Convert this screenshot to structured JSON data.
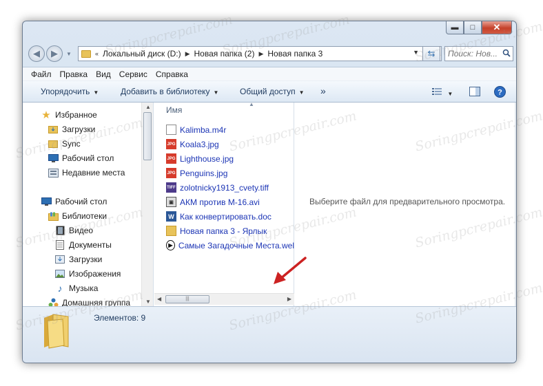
{
  "window": {
    "caption_buttons": {
      "minimize": "▬",
      "maximize": "□",
      "close": "✕"
    }
  },
  "address_bar": {
    "overflow": "«",
    "breadcrumbs": [
      "Локальный диск (D:)",
      "Новая папка (2)",
      "Новая папка 3"
    ],
    "search_placeholder": "Поиск: Нов..."
  },
  "menu": [
    "Файл",
    "Правка",
    "Вид",
    "Сервис",
    "Справка"
  ],
  "toolbar": {
    "organize": "Упорядочить",
    "add_to_library": "Добавить в библиотеку",
    "share": "Общий доступ",
    "more": "»"
  },
  "nav_pane": {
    "favorites": "Избранное",
    "favorites_items": [
      "Загрузки",
      "Sync",
      "Рабочий стол",
      "Недавние места"
    ],
    "desktop": "Рабочий стол",
    "libraries": "Библиотеки",
    "library_items": [
      "Видео",
      "Документы",
      "Загрузки",
      "Изображения",
      "Музыка"
    ],
    "homegroup": "Домашняя группа"
  },
  "file_list": {
    "column_name": "Имя",
    "files": [
      {
        "name": "Kalimba.m4r",
        "icon": "doc-icon"
      },
      {
        "name": "Koala3.jpg",
        "icon": "jpg-icon"
      },
      {
        "name": "Lighthouse.jpg",
        "icon": "jpg-icon"
      },
      {
        "name": "Penguins.jpg",
        "icon": "jpg-icon"
      },
      {
        "name": "zolotnicky1913_cvety.tiff",
        "icon": "tiff-icon"
      },
      {
        "name": "АКМ против М-16.avi",
        "icon": "avi-icon"
      },
      {
        "name": "Как конвертировать.doc",
        "icon": "word-icon"
      },
      {
        "name": "Новая папка 3 - Ярлык",
        "icon": "shortcut-icon"
      },
      {
        "name": "Самые Загадочные Места.wel",
        "icon": "web-icon"
      }
    ]
  },
  "preview": {
    "message": "Выберите файл для предварительного просмотра."
  },
  "details": {
    "count_text": "Элементов: 9"
  },
  "watermark": "Soringpcrepair.com",
  "colors": {
    "link": "#1c35b5",
    "arrow": "#cc2222",
    "close_button": "#c5412a"
  }
}
